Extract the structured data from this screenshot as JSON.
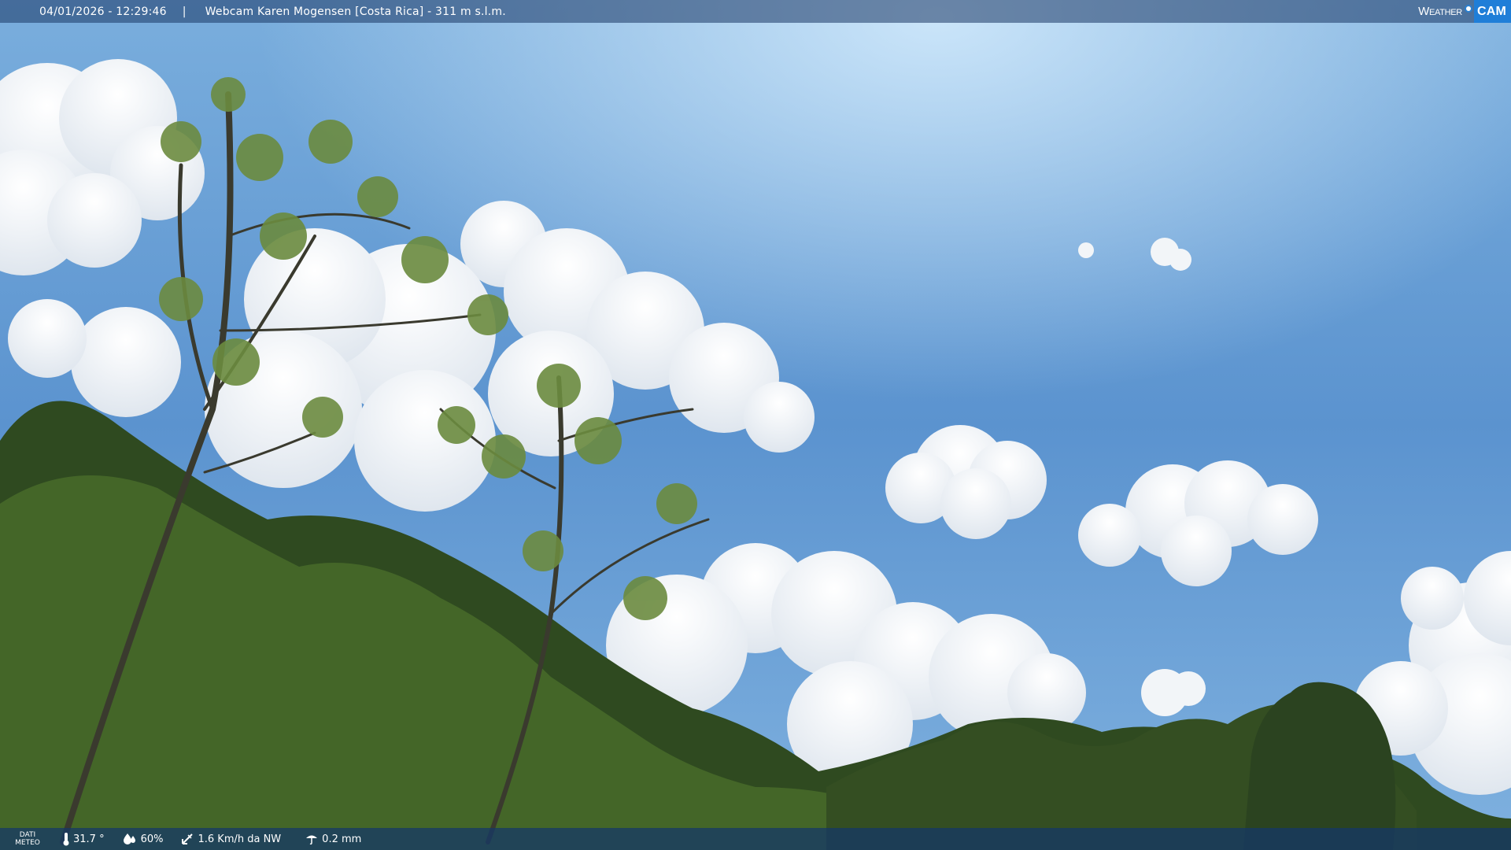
{
  "header": {
    "timestamp": "04/01/2026 - 12:29:46",
    "separator": "|",
    "title": "Webcam Karen Mogensen [Costa Rica] - 311 m s.l.m."
  },
  "brand": {
    "weather": "Weather",
    "cam": "CAM",
    "accent_color": "#1f7ed8"
  },
  "meteo": {
    "label_line1": "DATI",
    "label_line2": "METEO",
    "temperature": "31.7 °",
    "humidity": "60%",
    "wind": "1.6 Km/h da NW",
    "rain": "0.2 mm",
    "icons": [
      "thermometer-icon",
      "humidity-icon",
      "wind-icon",
      "rain-icon"
    ]
  }
}
